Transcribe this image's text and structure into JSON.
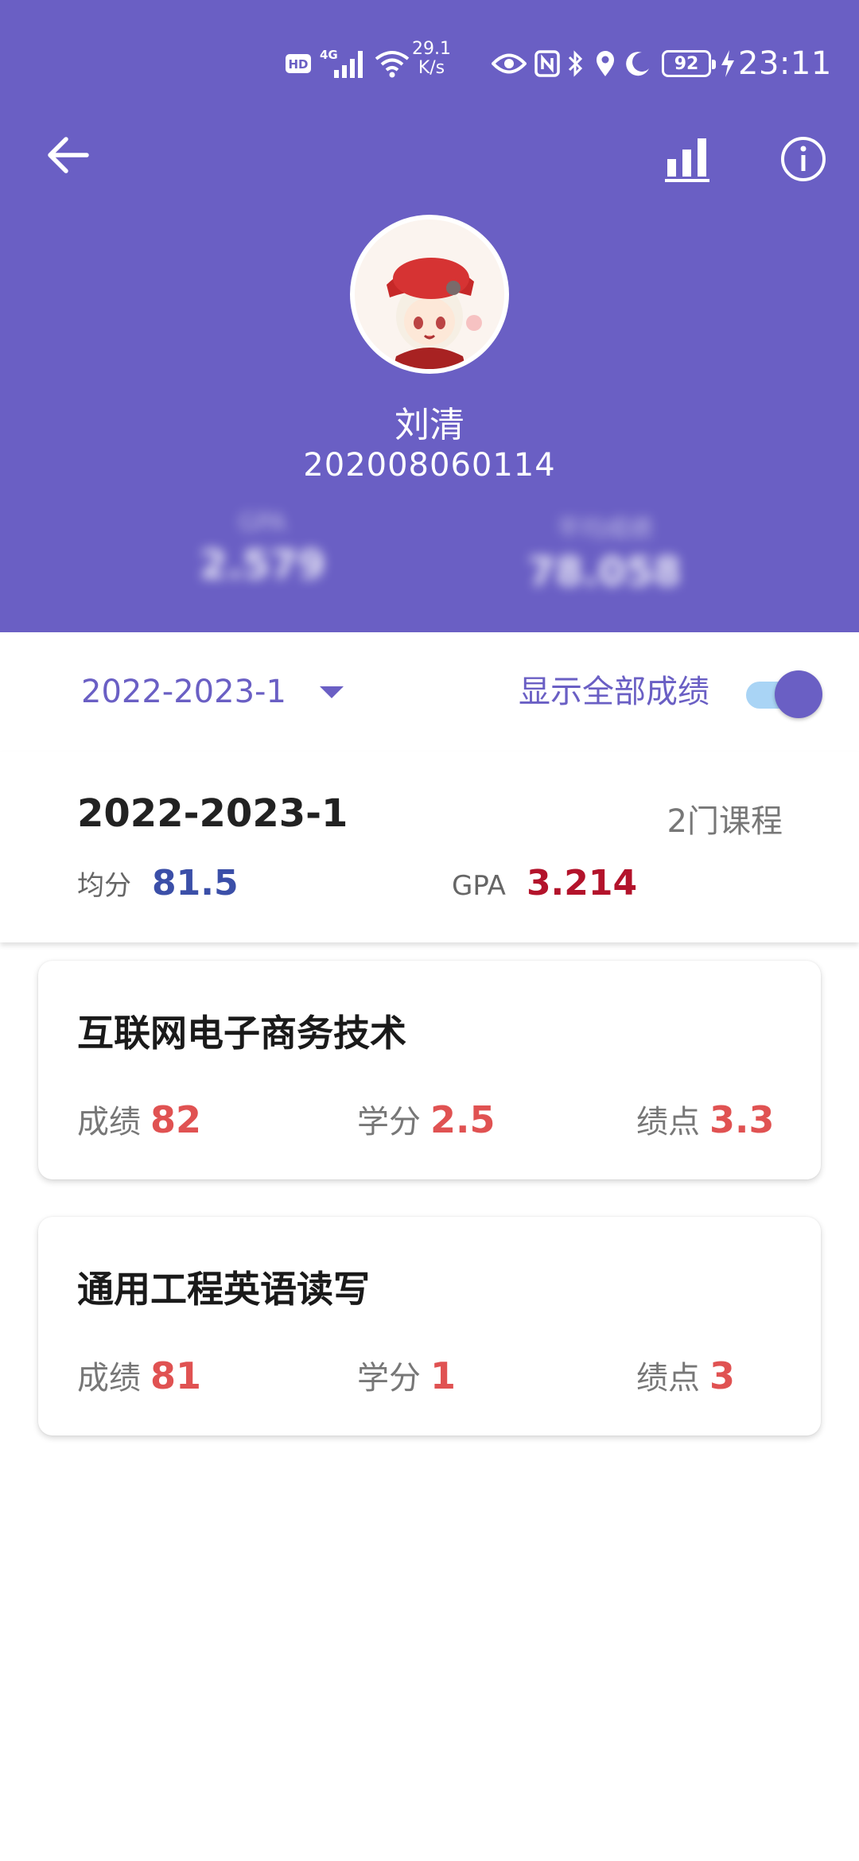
{
  "status_bar": {
    "hd": "HD",
    "network": "4G",
    "speed_value": "29.1",
    "speed_unit": "K/s",
    "battery": "92",
    "time": "23:11"
  },
  "profile": {
    "name": "刘清",
    "student_id": "202008060114",
    "stats_blurred": [
      {
        "label": "GPA",
        "value": "2.579"
      },
      {
        "label": "平均成绩",
        "value": "78.058"
      }
    ]
  },
  "filter": {
    "term": "2022-2023-1",
    "show_all_label": "显示全部成绩",
    "show_all_on": true
  },
  "summary": {
    "term": "2022-2023-1",
    "course_count": "2门课程",
    "avg_label": "均分",
    "avg_value": "81.5",
    "gpa_label": "GPA",
    "gpa_value": "3.214"
  },
  "courses": [
    {
      "name": "互联网电子商务技术",
      "score_label": "成绩",
      "score": "82",
      "credit_label": "学分",
      "credit": "2.5",
      "point_label": "绩点",
      "point": "3.3"
    },
    {
      "name": "通用工程英语读写",
      "score_label": "成绩",
      "score": "81",
      "credit_label": "学分",
      "credit": "1",
      "point_label": "绩点",
      "point": "3"
    }
  ],
  "colors": {
    "primary": "#6a5fc4",
    "avg_value": "#3b4fa8",
    "gpa_value": "#b3132b",
    "metric_value": "#e05252",
    "toggle_track": "#a9d4f5"
  },
  "icons": [
    "back-arrow-icon",
    "bar-chart-icon",
    "info-icon",
    "hd-icon",
    "signal-icon",
    "wifi-icon",
    "eye-icon",
    "nfc-icon",
    "bluetooth-icon",
    "location-icon",
    "moon-icon",
    "battery-icon",
    "charging-icon",
    "dropdown-caret-icon"
  ]
}
